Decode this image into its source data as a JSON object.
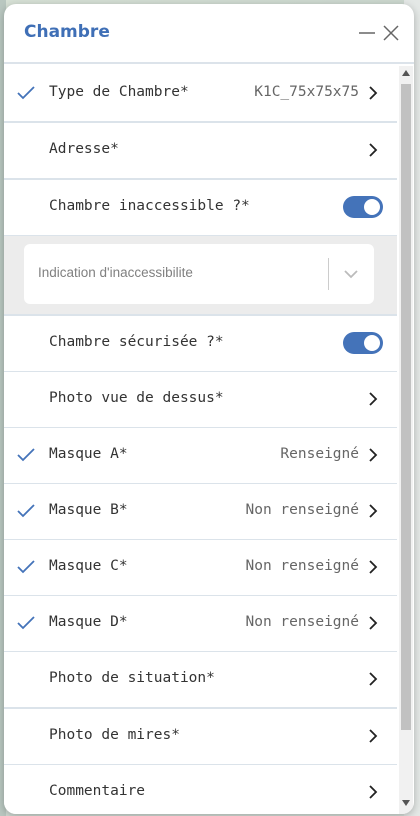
{
  "header": {
    "title": "Chambre"
  },
  "rows": [
    {
      "label": "Type de Chambre*",
      "value": "K1C_75x75x75",
      "checked": true
    },
    {
      "label": "Adresse*",
      "value": "",
      "checked": false
    },
    {
      "label": "Chambre inaccessible ?*",
      "toggle": true
    },
    {
      "label": "Chambre sécurisée ?*",
      "toggle": true
    },
    {
      "label": "Photo vue de dessus*",
      "value": "",
      "checked": false
    },
    {
      "label": "Masque A*",
      "value": "Renseigné",
      "checked": true
    },
    {
      "label": "Masque B*",
      "value": "Non renseigné",
      "checked": true
    },
    {
      "label": "Masque C*",
      "value": "Non renseigné",
      "checked": true
    },
    {
      "label": "Masque D*",
      "value": "Non renseigné",
      "checked": true
    },
    {
      "label": "Photo de situation*",
      "value": "",
      "checked": false
    },
    {
      "label": "Photo de mires*",
      "value": "",
      "checked": false
    },
    {
      "label": "Commentaire",
      "value": "",
      "checked": false
    }
  ],
  "inaccessibility_select": {
    "placeholder": "Indication d'inaccessibilite"
  },
  "colors": {
    "accent": "#4473b9",
    "title": "#3f6fb6"
  },
  "icons": {
    "check": "check-icon",
    "chevron": "chevron-right-icon",
    "minimize": "minimize-icon",
    "close": "close-icon",
    "dropdown": "chevron-down-icon"
  }
}
